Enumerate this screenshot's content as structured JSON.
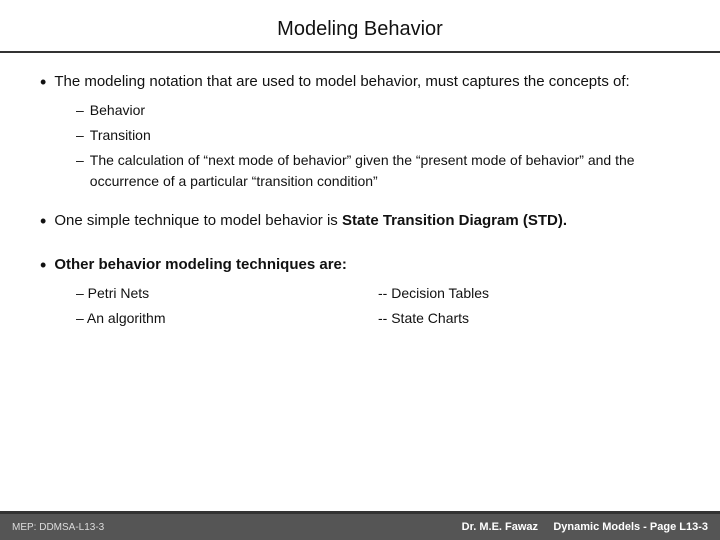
{
  "title": "Modeling Behavior",
  "bullets": [
    {
      "id": "bullet1",
      "text": "The modeling notation that are used to model behavior, must captures the concepts of:",
      "subbullets": [
        {
          "id": "sub1",
          "text": "Behavior"
        },
        {
          "id": "sub2",
          "text": "Transition"
        },
        {
          "id": "sub3",
          "text": "The calculation of “next mode of behavior” given the “present mode of behavior” and the occurrence  of a particular “transition condition”"
        }
      ]
    },
    {
      "id": "bullet2",
      "text_plain": "One simple technique to model behavior is State Transition Diagram (STD).",
      "text_bold_prefix": "One simple technique to model behavior is ",
      "text_bold": "State Transition Diagram (STD)."
    },
    {
      "id": "bullet3",
      "text_bold": "Other behavior modeling techniques are:",
      "two_col": [
        {
          "col": "left",
          "prefix": "–  Petri Nets",
          "suffix": ""
        },
        {
          "col": "right",
          "prefix": "-- Decision Tables",
          "suffix": ""
        },
        {
          "col": "left",
          "prefix": "–  An algorithm",
          "suffix": ""
        },
        {
          "col": "right",
          "prefix": "-- State Charts",
          "suffix": ""
        }
      ]
    }
  ],
  "footer": {
    "left": "MEP: DDMSA-L13-3",
    "right_author": "Dr. M.E. Fawaz",
    "right_page": "Dynamic Models  - Page L13-3"
  }
}
